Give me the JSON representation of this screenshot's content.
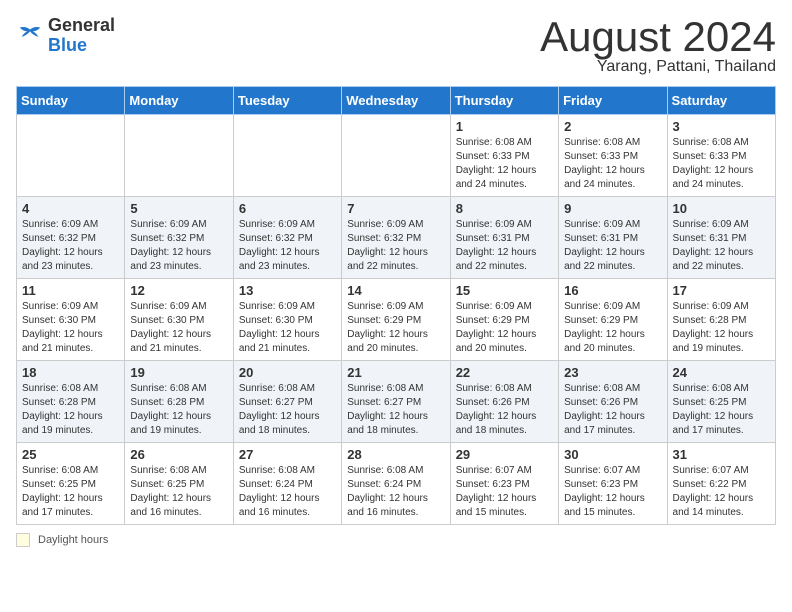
{
  "header": {
    "logo_general": "General",
    "logo_blue": "Blue",
    "title": "August 2024",
    "subtitle": "Yarang, Pattani, Thailand"
  },
  "days_of_week": [
    "Sunday",
    "Monday",
    "Tuesday",
    "Wednesday",
    "Thursday",
    "Friday",
    "Saturday"
  ],
  "weeks": [
    [
      {
        "day": "",
        "info": ""
      },
      {
        "day": "",
        "info": ""
      },
      {
        "day": "",
        "info": ""
      },
      {
        "day": "",
        "info": ""
      },
      {
        "day": "1",
        "info": "Sunrise: 6:08 AM\nSunset: 6:33 PM\nDaylight: 12 hours\nand 24 minutes."
      },
      {
        "day": "2",
        "info": "Sunrise: 6:08 AM\nSunset: 6:33 PM\nDaylight: 12 hours\nand 24 minutes."
      },
      {
        "day": "3",
        "info": "Sunrise: 6:08 AM\nSunset: 6:33 PM\nDaylight: 12 hours\nand 24 minutes."
      }
    ],
    [
      {
        "day": "4",
        "info": "Sunrise: 6:09 AM\nSunset: 6:32 PM\nDaylight: 12 hours\nand 23 minutes."
      },
      {
        "day": "5",
        "info": "Sunrise: 6:09 AM\nSunset: 6:32 PM\nDaylight: 12 hours\nand 23 minutes."
      },
      {
        "day": "6",
        "info": "Sunrise: 6:09 AM\nSunset: 6:32 PM\nDaylight: 12 hours\nand 23 minutes."
      },
      {
        "day": "7",
        "info": "Sunrise: 6:09 AM\nSunset: 6:32 PM\nDaylight: 12 hours\nand 22 minutes."
      },
      {
        "day": "8",
        "info": "Sunrise: 6:09 AM\nSunset: 6:31 PM\nDaylight: 12 hours\nand 22 minutes."
      },
      {
        "day": "9",
        "info": "Sunrise: 6:09 AM\nSunset: 6:31 PM\nDaylight: 12 hours\nand 22 minutes."
      },
      {
        "day": "10",
        "info": "Sunrise: 6:09 AM\nSunset: 6:31 PM\nDaylight: 12 hours\nand 22 minutes."
      }
    ],
    [
      {
        "day": "11",
        "info": "Sunrise: 6:09 AM\nSunset: 6:30 PM\nDaylight: 12 hours\nand 21 minutes."
      },
      {
        "day": "12",
        "info": "Sunrise: 6:09 AM\nSunset: 6:30 PM\nDaylight: 12 hours\nand 21 minutes."
      },
      {
        "day": "13",
        "info": "Sunrise: 6:09 AM\nSunset: 6:30 PM\nDaylight: 12 hours\nand 21 minutes."
      },
      {
        "day": "14",
        "info": "Sunrise: 6:09 AM\nSunset: 6:29 PM\nDaylight: 12 hours\nand 20 minutes."
      },
      {
        "day": "15",
        "info": "Sunrise: 6:09 AM\nSunset: 6:29 PM\nDaylight: 12 hours\nand 20 minutes."
      },
      {
        "day": "16",
        "info": "Sunrise: 6:09 AM\nSunset: 6:29 PM\nDaylight: 12 hours\nand 20 minutes."
      },
      {
        "day": "17",
        "info": "Sunrise: 6:09 AM\nSunset: 6:28 PM\nDaylight: 12 hours\nand 19 minutes."
      }
    ],
    [
      {
        "day": "18",
        "info": "Sunrise: 6:08 AM\nSunset: 6:28 PM\nDaylight: 12 hours\nand 19 minutes."
      },
      {
        "day": "19",
        "info": "Sunrise: 6:08 AM\nSunset: 6:28 PM\nDaylight: 12 hours\nand 19 minutes."
      },
      {
        "day": "20",
        "info": "Sunrise: 6:08 AM\nSunset: 6:27 PM\nDaylight: 12 hours\nand 18 minutes."
      },
      {
        "day": "21",
        "info": "Sunrise: 6:08 AM\nSunset: 6:27 PM\nDaylight: 12 hours\nand 18 minutes."
      },
      {
        "day": "22",
        "info": "Sunrise: 6:08 AM\nSunset: 6:26 PM\nDaylight: 12 hours\nand 18 minutes."
      },
      {
        "day": "23",
        "info": "Sunrise: 6:08 AM\nSunset: 6:26 PM\nDaylight: 12 hours\nand 17 minutes."
      },
      {
        "day": "24",
        "info": "Sunrise: 6:08 AM\nSunset: 6:25 PM\nDaylight: 12 hours\nand 17 minutes."
      }
    ],
    [
      {
        "day": "25",
        "info": "Sunrise: 6:08 AM\nSunset: 6:25 PM\nDaylight: 12 hours\nand 17 minutes."
      },
      {
        "day": "26",
        "info": "Sunrise: 6:08 AM\nSunset: 6:25 PM\nDaylight: 12 hours\nand 16 minutes."
      },
      {
        "day": "27",
        "info": "Sunrise: 6:08 AM\nSunset: 6:24 PM\nDaylight: 12 hours\nand 16 minutes."
      },
      {
        "day": "28",
        "info": "Sunrise: 6:08 AM\nSunset: 6:24 PM\nDaylight: 12 hours\nand 16 minutes."
      },
      {
        "day": "29",
        "info": "Sunrise: 6:07 AM\nSunset: 6:23 PM\nDaylight: 12 hours\nand 15 minutes."
      },
      {
        "day": "30",
        "info": "Sunrise: 6:07 AM\nSunset: 6:23 PM\nDaylight: 12 hours\nand 15 minutes."
      },
      {
        "day": "31",
        "info": "Sunrise: 6:07 AM\nSunset: 6:22 PM\nDaylight: 12 hours\nand 14 minutes."
      }
    ]
  ],
  "footer": {
    "box_label": "Daylight hours"
  }
}
